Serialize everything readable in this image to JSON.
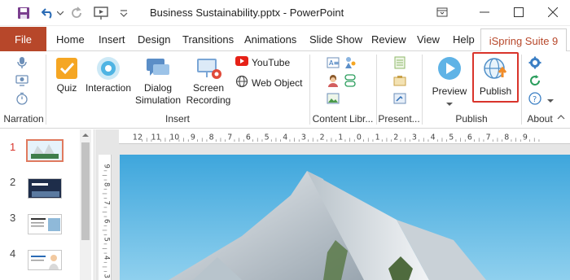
{
  "window": {
    "title": "Business Sustainability.pptx  -  PowerPoint",
    "controls": [
      "restore-ribbon",
      "minimize",
      "maximize",
      "close"
    ]
  },
  "tabs": {
    "file": "File",
    "items": [
      "Home",
      "Insert",
      "Design",
      "Transitions",
      "Animations",
      "Slide Show",
      "Review",
      "View",
      "Help"
    ],
    "active": "iSpring Suite 9"
  },
  "ribbon": {
    "narration": {
      "label": "Narration"
    },
    "insert": {
      "label": "Insert",
      "quiz": "Quiz",
      "interaction": "Interaction",
      "dialog_line1": "Dialog",
      "dialog_line2": "Simulation",
      "screen_line1": "Screen",
      "screen_line2": "Recording",
      "youtube": "YouTube",
      "web_object": "Web Object"
    },
    "content_library": {
      "label": "Content Libr..."
    },
    "presenter": {
      "label": "Present..."
    },
    "publish": {
      "label": "Publish",
      "preview": "Preview",
      "publish_btn": "Publish"
    },
    "about": {
      "label": "About"
    }
  },
  "rulers": {
    "horizontal": [
      "12",
      "11",
      "10",
      "9",
      "8",
      "7",
      "6",
      "5",
      "4",
      "3",
      "2",
      "1",
      "0",
      "1",
      "2",
      "3",
      "4",
      "5",
      "6",
      "7",
      "8",
      "9"
    ],
    "vertical": [
      "9",
      "8",
      "7",
      "6",
      "5",
      "4",
      "3"
    ]
  },
  "slides": [
    {
      "number": "1",
      "selected": true
    },
    {
      "number": "2",
      "selected": false
    },
    {
      "number": "3",
      "selected": false
    },
    {
      "number": "4",
      "selected": false
    }
  ],
  "colors": {
    "accent": "#b7472a",
    "highlight": "#d9342b",
    "sky": "#3ea6dc"
  }
}
